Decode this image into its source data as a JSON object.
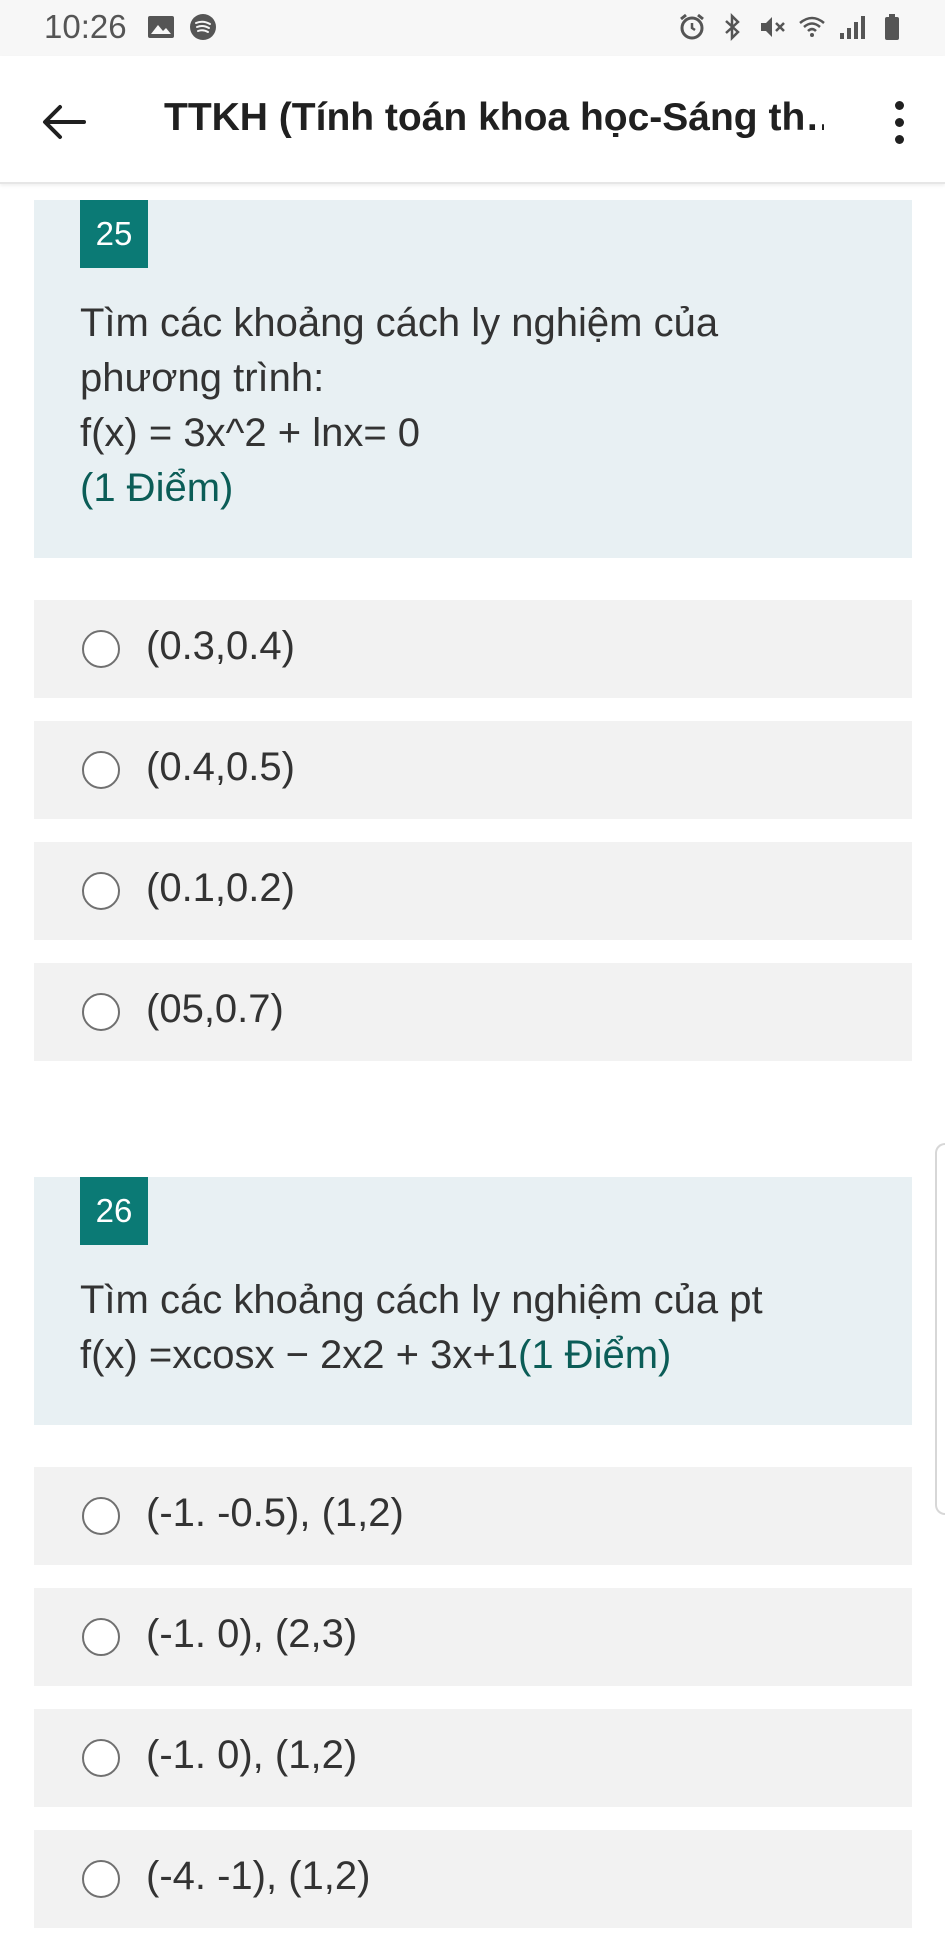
{
  "status_bar": {
    "time": "10:26",
    "left_icons": [
      "gallery-icon",
      "spotify-icon"
    ],
    "right_icons": [
      "alarm-icon",
      "bluetooth-icon",
      "mute-icon",
      "wifi-icon",
      "signal-icon",
      "battery-icon"
    ]
  },
  "app_bar": {
    "title": "TTKH (Tính toán khoa học-Sáng th…"
  },
  "questions": [
    {
      "number": "25",
      "text_lines": [
        "Tìm các khoảng cách ly nghiệm của",
        "phương trình:",
        "f(x) = 3x^2 + lnx= 0"
      ],
      "points": "(1 Điểm)",
      "options": [
        "(0.3,0.4)",
        "(0.4,0.5)",
        "(0.1,0.2)",
        "(05,0.7)"
      ]
    },
    {
      "number": "26",
      "text_lines": [
        "Tìm các khoảng cách ly nghiệm của pt",
        "f(x) =xcosx − 2x2 + 3x+1"
      ],
      "points": "(1 Điểm)",
      "options": [
        "(-1. -0.5), (1,2)",
        "(-1. 0), (2,3)",
        "(-1. 0), (1,2)",
        "(-4. -1), (1,2)"
      ]
    }
  ],
  "colors": {
    "accent": "#0b7a75",
    "points_text": "#0b5d57",
    "question_bg": "#e8f0f3",
    "option_bg": "#f2f2f2"
  }
}
